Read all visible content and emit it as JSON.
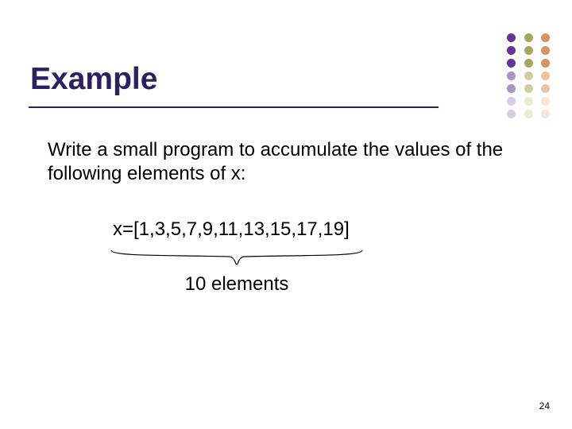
{
  "title": "Example",
  "body": "Write a small program to accumulate the values of the following elements of x:",
  "array_line": "x=[1,3,5,7,9,11,13,15,17,19]",
  "elements_label": "10 elements",
  "page_number": "24"
}
